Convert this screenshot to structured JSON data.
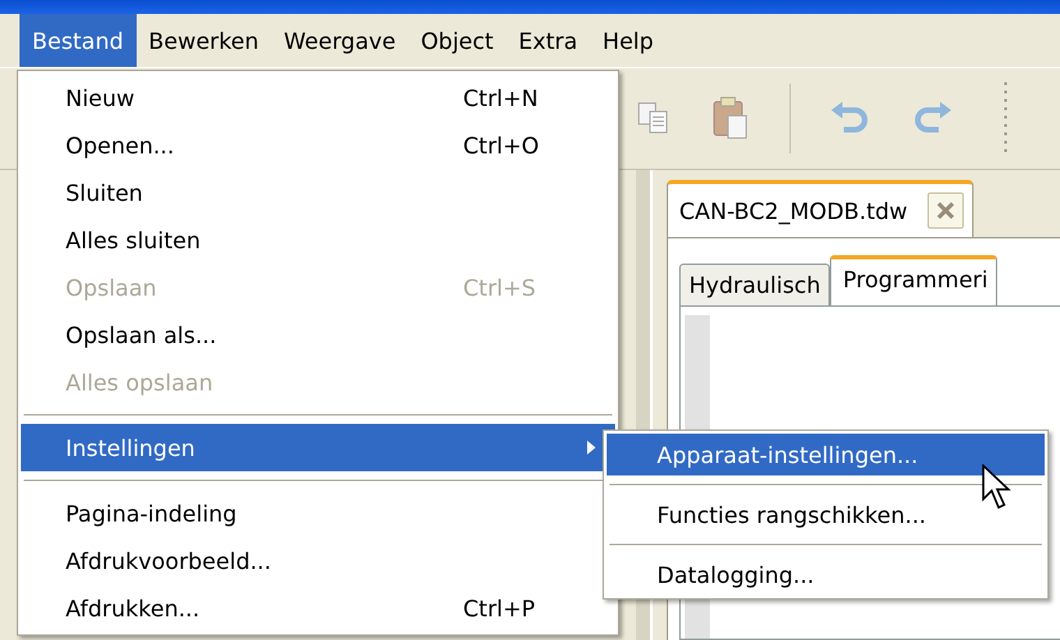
{
  "menubar": [
    {
      "label": "Bestand",
      "selected": true
    },
    {
      "label": "Bewerken",
      "selected": false
    },
    {
      "label": "Weergave",
      "selected": false
    },
    {
      "label": "Object",
      "selected": false
    },
    {
      "label": "Extra",
      "selected": false
    },
    {
      "label": "Help",
      "selected": false
    }
  ],
  "document_tab": {
    "title": "CAN-BC2_MODB.tdw"
  },
  "view_tabs": [
    {
      "label": "Hydraulisch",
      "selected": false
    },
    {
      "label": "Programmeri",
      "selected": true
    }
  ],
  "file_menu": [
    {
      "kind": "item",
      "label": "Nieuw",
      "shortcut": "Ctrl+N",
      "disabled": false,
      "selected": false
    },
    {
      "kind": "item",
      "label": "Openen...",
      "shortcut": "Ctrl+O",
      "disabled": false,
      "selected": false
    },
    {
      "kind": "item",
      "label": "Sluiten",
      "disabled": false,
      "selected": false
    },
    {
      "kind": "item",
      "label": "Alles sluiten",
      "disabled": false,
      "selected": false
    },
    {
      "kind": "item",
      "label": "Opslaan",
      "shortcut": "Ctrl+S",
      "disabled": true,
      "selected": false
    },
    {
      "kind": "item",
      "label": "Opslaan als...",
      "disabled": false,
      "selected": false
    },
    {
      "kind": "item",
      "label": "Alles opslaan",
      "disabled": true,
      "selected": false
    },
    {
      "kind": "separator"
    },
    {
      "kind": "submenu",
      "label": "Instellingen",
      "disabled": false,
      "selected": true
    },
    {
      "kind": "separator"
    },
    {
      "kind": "item",
      "label": "Pagina-indeling",
      "disabled": false,
      "selected": false
    },
    {
      "kind": "item",
      "label": "Afdrukvoorbeeld...",
      "disabled": false,
      "selected": false
    },
    {
      "kind": "item",
      "label": "Afdrukken...",
      "shortcut": "Ctrl+P",
      "disabled": false,
      "selected": false
    }
  ],
  "settings_submenu": [
    {
      "kind": "item",
      "label": "Apparaat-instellingen...",
      "selected": true
    },
    {
      "kind": "separator"
    },
    {
      "kind": "item",
      "label": "Functies rangschikken...",
      "selected": false
    },
    {
      "kind": "separator"
    },
    {
      "kind": "item",
      "label": "Datalogging...",
      "selected": false
    }
  ]
}
